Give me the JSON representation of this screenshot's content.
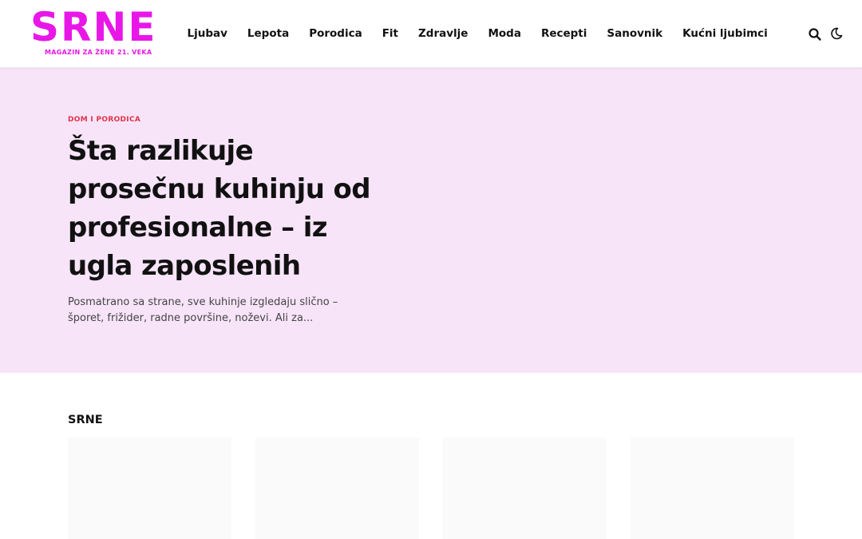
{
  "header": {
    "logo_text": "SRNE",
    "logo_tagline": "MAGAZIN ZA ŽENE 21. VEKA",
    "brand_color": "#e817e8",
    "nav": [
      "Ljubav",
      "Lepota",
      "Porodica",
      "Fit",
      "Zdravlje",
      "Moda",
      "Recepti",
      "Sanovnik",
      "Kućni ljubimci"
    ],
    "icons": [
      "search-icon",
      "moon-icon"
    ]
  },
  "hero": {
    "background_color": "#f7e4f9",
    "category": "DOM I PORODICA",
    "category_color": "#e0344a",
    "title": "Šta razlikuje prosečnu kuhinju od profesionalne – iz ugla zaposlenih",
    "excerpt": "Posmatrano sa strane, sve kuhinje izgledaju slično – šporet, frižider, radne površine, noževi. Ali za..."
  },
  "section": {
    "title": "SRNE"
  }
}
